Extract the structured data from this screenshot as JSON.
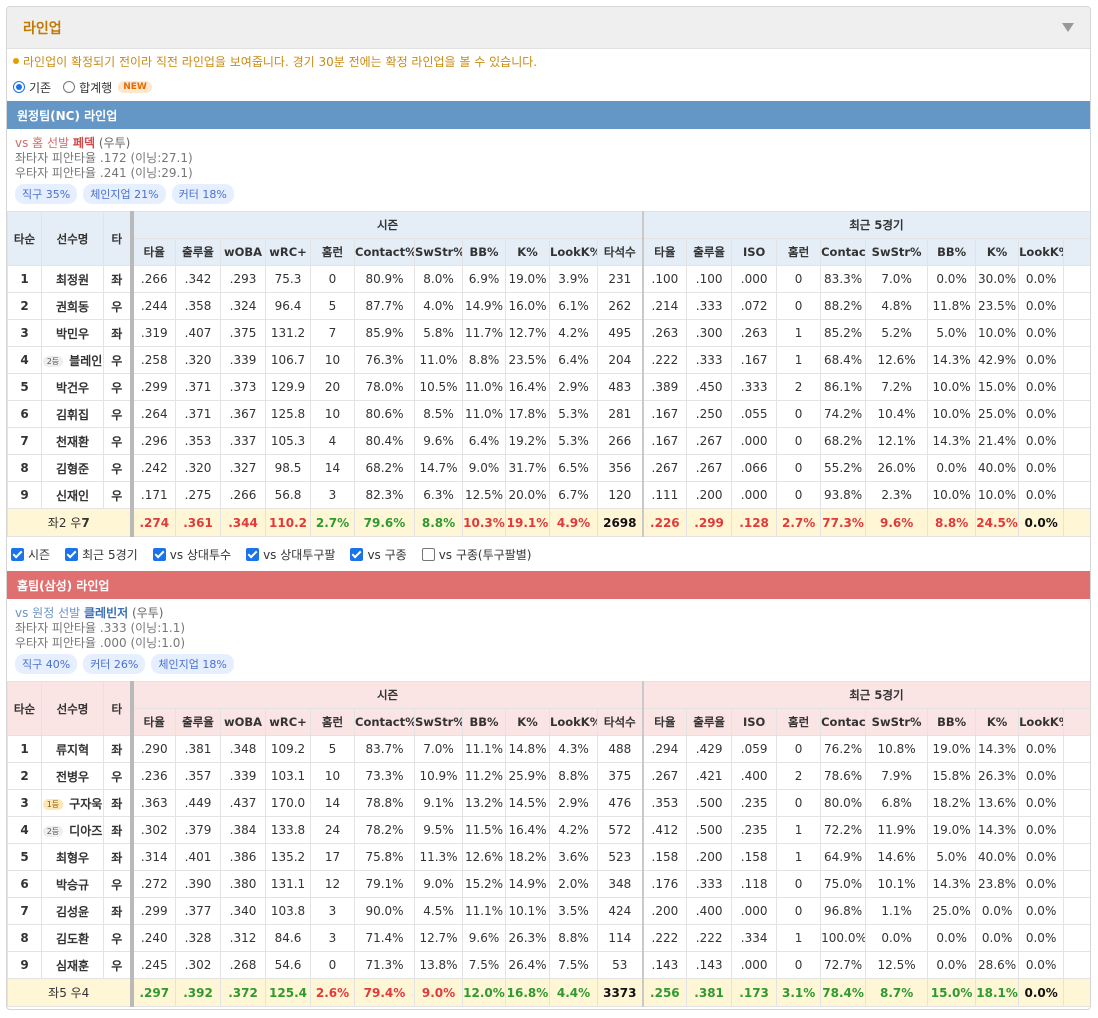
{
  "panel": {
    "title": "라인업"
  },
  "notice": "라인업이 확정되기 전이라 직전 라인업을 보여줍니다. 경기 30분 전에는 확정 라인업을 볼 수 있습니다.",
  "view_options": [
    {
      "label": "기존",
      "selected": true
    },
    {
      "label": "합계행",
      "selected": false,
      "badge": "NEW"
    }
  ],
  "columns": {
    "fixed": [
      "타순",
      "선수명",
      "타"
    ],
    "season_group": "시즌",
    "recent_group": "최근 5경기",
    "season": [
      "타율",
      "출루율",
      "wOBA",
      "wRC+",
      "홈런",
      "Contact%",
      "SwStr%",
      "BB%",
      "K%",
      "LookK%",
      "타석수"
    ],
    "recent": [
      "타율",
      "출루율",
      "ISO",
      "홈런",
      "Contact%",
      "SwStr%",
      "BB%",
      "K%",
      "LookK%"
    ]
  },
  "away": {
    "header": "원정팀(NC) 라인업",
    "vs_prefix": "vs 홈 선발",
    "pitcher": "페덱",
    "pitcher_hand": "(우투)",
    "split_left": "좌타자 피안타율 .172 (이닝:27.1)",
    "split_right": "우타자 피안타율 .241 (이닝:29.1)",
    "pitch_mix": [
      "직구 35%",
      "체인지업 21%",
      "커터 18%"
    ],
    "rows": [
      {
        "order": "1",
        "badge": "",
        "name": "최정원",
        "hand": "좌",
        "season": [
          ".266",
          ".342",
          ".293",
          "75.3",
          "0",
          "80.9%",
          "8.0%",
          "6.9%",
          "19.0%",
          "3.9%",
          "231"
        ],
        "recent": [
          ".100",
          ".100",
          ".000",
          "0",
          "83.3%",
          "7.0%",
          "0.0%",
          "30.0%",
          "0.0%"
        ]
      },
      {
        "order": "2",
        "badge": "",
        "name": "권희동",
        "hand": "우",
        "season": [
          ".244",
          ".358",
          ".324",
          "96.4",
          "5",
          "87.7%",
          "4.0%",
          "14.9%",
          "16.0%",
          "6.1%",
          "262"
        ],
        "recent": [
          ".214",
          ".333",
          ".072",
          "0",
          "88.2%",
          "4.8%",
          "11.8%",
          "23.5%",
          "0.0%"
        ]
      },
      {
        "order": "3",
        "badge": "",
        "name": "박민우",
        "hand": "좌",
        "season": [
          ".319",
          ".407",
          ".375",
          "131.2",
          "7",
          "85.9%",
          "5.8%",
          "11.7%",
          "12.7%",
          "4.2%",
          "495"
        ],
        "recent": [
          ".263",
          ".300",
          ".263",
          "1",
          "85.2%",
          "5.2%",
          "5.0%",
          "10.0%",
          "0.0%"
        ]
      },
      {
        "order": "4",
        "badge": "2등",
        "name": "블레인",
        "hand": "우",
        "season": [
          ".258",
          ".320",
          ".339",
          "106.7",
          "10",
          "76.3%",
          "11.0%",
          "8.8%",
          "23.5%",
          "6.4%",
          "204"
        ],
        "recent": [
          ".222",
          ".333",
          ".167",
          "1",
          "68.4%",
          "12.6%",
          "14.3%",
          "42.9%",
          "0.0%"
        ]
      },
      {
        "order": "5",
        "badge": "",
        "name": "박건우",
        "hand": "우",
        "season": [
          ".299",
          ".371",
          ".373",
          "129.9",
          "20",
          "78.0%",
          "10.5%",
          "11.0%",
          "16.4%",
          "2.9%",
          "483"
        ],
        "recent": [
          ".389",
          ".450",
          ".333",
          "2",
          "86.1%",
          "7.2%",
          "10.0%",
          "15.0%",
          "0.0%"
        ]
      },
      {
        "order": "6",
        "badge": "",
        "name": "김휘집",
        "hand": "우",
        "season": [
          ".264",
          ".371",
          ".367",
          "125.8",
          "10",
          "80.6%",
          "8.5%",
          "11.0%",
          "17.8%",
          "5.3%",
          "281"
        ],
        "recent": [
          ".167",
          ".250",
          ".055",
          "0",
          "74.2%",
          "10.4%",
          "10.0%",
          "25.0%",
          "0.0%"
        ]
      },
      {
        "order": "7",
        "badge": "",
        "name": "천재환",
        "hand": "우",
        "season": [
          ".296",
          ".353",
          ".337",
          "105.3",
          "4",
          "80.4%",
          "9.6%",
          "6.4%",
          "19.2%",
          "5.3%",
          "266"
        ],
        "recent": [
          ".167",
          ".267",
          ".000",
          "0",
          "68.2%",
          "12.1%",
          "14.3%",
          "21.4%",
          "0.0%"
        ]
      },
      {
        "order": "8",
        "badge": "",
        "name": "김형준",
        "hand": "우",
        "season": [
          ".242",
          ".320",
          ".327",
          "98.5",
          "14",
          "68.2%",
          "14.7%",
          "9.0%",
          "31.7%",
          "6.5%",
          "356"
        ],
        "recent": [
          ".267",
          ".267",
          ".066",
          "0",
          "55.2%",
          "26.0%",
          "0.0%",
          "40.0%",
          "0.0%"
        ]
      },
      {
        "order": "9",
        "badge": "",
        "name": "신재인",
        "hand": "우",
        "season": [
          ".171",
          ".275",
          ".266",
          "56.8",
          "3",
          "82.3%",
          "6.3%",
          "12.5%",
          "20.0%",
          "6.7%",
          "120"
        ],
        "recent": [
          ".111",
          ".200",
          ".000",
          "0",
          "93.8%",
          "2.3%",
          "10.0%",
          "10.0%",
          "0.0%"
        ]
      }
    ],
    "total": {
      "left_prefix": "좌2 우",
      "left_strong": "7",
      "season": [
        ".274",
        ".361",
        ".344",
        "110.2",
        "2.7%",
        "79.6%",
        "8.8%",
        "10.3%",
        "19.1%",
        "4.9%",
        "2698"
      ],
      "season_colors": [
        "red",
        "red",
        "red",
        "red",
        "green",
        "green",
        "green",
        "red",
        "red",
        "red",
        "black"
      ],
      "recent": [
        ".226",
        ".299",
        ".128",
        "2.7%",
        "77.3%",
        "9.6%",
        "8.8%",
        "24.5%",
        "0.0%"
      ],
      "recent_colors": [
        "red",
        "red",
        "red",
        "red",
        "red",
        "red",
        "red",
        "red",
        "black"
      ]
    }
  },
  "filters": [
    {
      "label": "시즌",
      "checked": true
    },
    {
      "label": "최근 5경기",
      "checked": true
    },
    {
      "label": "vs 상대투수",
      "checked": true
    },
    {
      "label": "vs 상대투구팔",
      "checked": true
    },
    {
      "label": "vs 구종",
      "checked": true
    },
    {
      "label": "vs 구종(투구팔별)",
      "checked": false
    }
  ],
  "home": {
    "header": "홈팀(삼성) 라인업",
    "vs_prefix": "vs 원정 선발",
    "pitcher": "클레빈저",
    "pitcher_hand": "(우투)",
    "split_left": "좌타자 피안타율 .333 (이닝:1.1)",
    "split_right": "우타자 피안타율 .000 (이닝:1.0)",
    "pitch_mix": [
      "직구 40%",
      "커터 26%",
      "체인지업 18%"
    ],
    "rows": [
      {
        "order": "1",
        "badge": "",
        "name": "류지혁",
        "hand": "좌",
        "season": [
          ".290",
          ".381",
          ".348",
          "109.2",
          "5",
          "83.7%",
          "7.0%",
          "11.1%",
          "14.8%",
          "4.3%",
          "488"
        ],
        "recent": [
          ".294",
          ".429",
          ".059",
          "0",
          "76.2%",
          "10.8%",
          "19.0%",
          "14.3%",
          "0.0%"
        ]
      },
      {
        "order": "2",
        "badge": "",
        "name": "전병우",
        "hand": "우",
        "season": [
          ".236",
          ".357",
          ".339",
          "103.1",
          "10",
          "73.3%",
          "10.9%",
          "11.2%",
          "25.9%",
          "8.8%",
          "375"
        ],
        "recent": [
          ".267",
          ".421",
          ".400",
          "2",
          "78.6%",
          "7.9%",
          "15.8%",
          "26.3%",
          "0.0%"
        ]
      },
      {
        "order": "3",
        "badge": "1등",
        "name": "구자욱",
        "hand": "좌",
        "season": [
          ".363",
          ".449",
          ".437",
          "170.0",
          "14",
          "78.8%",
          "9.1%",
          "13.2%",
          "14.5%",
          "2.9%",
          "476"
        ],
        "recent": [
          ".353",
          ".500",
          ".235",
          "0",
          "80.0%",
          "6.8%",
          "18.2%",
          "13.6%",
          "0.0%"
        ]
      },
      {
        "order": "4",
        "badge": "2등",
        "name": "디아즈",
        "hand": "좌",
        "season": [
          ".302",
          ".379",
          ".384",
          "133.8",
          "24",
          "78.2%",
          "9.5%",
          "11.5%",
          "16.4%",
          "4.2%",
          "572"
        ],
        "recent": [
          ".412",
          ".500",
          ".235",
          "1",
          "72.2%",
          "11.9%",
          "19.0%",
          "14.3%",
          "0.0%"
        ]
      },
      {
        "order": "5",
        "badge": "",
        "name": "최형우",
        "hand": "좌",
        "season": [
          ".314",
          ".401",
          ".386",
          "135.2",
          "17",
          "75.8%",
          "11.3%",
          "12.6%",
          "18.2%",
          "3.6%",
          "523"
        ],
        "recent": [
          ".158",
          ".200",
          ".158",
          "1",
          "64.9%",
          "14.6%",
          "5.0%",
          "40.0%",
          "0.0%"
        ]
      },
      {
        "order": "6",
        "badge": "",
        "name": "박승규",
        "hand": "우",
        "season": [
          ".272",
          ".390",
          ".380",
          "131.1",
          "12",
          "79.1%",
          "9.0%",
          "15.2%",
          "14.9%",
          "2.0%",
          "348"
        ],
        "recent": [
          ".176",
          ".333",
          ".118",
          "0",
          "75.0%",
          "10.1%",
          "14.3%",
          "23.8%",
          "0.0%"
        ]
      },
      {
        "order": "7",
        "badge": "",
        "name": "김성윤",
        "hand": "좌",
        "season": [
          ".299",
          ".377",
          ".340",
          "103.8",
          "3",
          "90.0%",
          "4.5%",
          "11.1%",
          "10.1%",
          "3.5%",
          "424"
        ],
        "recent": [
          ".200",
          ".400",
          ".000",
          "0",
          "96.8%",
          "1.1%",
          "25.0%",
          "0.0%",
          "0.0%"
        ]
      },
      {
        "order": "8",
        "badge": "",
        "name": "김도환",
        "hand": "우",
        "season": [
          ".240",
          ".328",
          ".312",
          "84.6",
          "3",
          "71.4%",
          "12.7%",
          "9.6%",
          "26.3%",
          "8.8%",
          "114"
        ],
        "recent": [
          ".222",
          ".222",
          ".334",
          "1",
          "100.0%",
          "0.0%",
          "0.0%",
          "0.0%",
          "0.0%"
        ]
      },
      {
        "order": "9",
        "badge": "",
        "name": "심재훈",
        "hand": "우",
        "season": [
          ".245",
          ".302",
          ".268",
          "54.6",
          "0",
          "71.3%",
          "13.8%",
          "7.5%",
          "26.4%",
          "7.5%",
          "53"
        ],
        "recent": [
          ".143",
          ".143",
          ".000",
          "0",
          "72.7%",
          "12.5%",
          "0.0%",
          "28.6%",
          "0.0%"
        ]
      }
    ],
    "total": {
      "left_prefix": "좌5 우4",
      "left_strong": "",
      "season": [
        ".297",
        ".392",
        ".372",
        "125.4",
        "2.6%",
        "79.4%",
        "9.0%",
        "12.0%",
        "16.8%",
        "4.4%",
        "3373"
      ],
      "season_colors": [
        "green",
        "green",
        "green",
        "green",
        "red",
        "red",
        "red",
        "green",
        "green",
        "green",
        "black"
      ],
      "recent": [
        ".256",
        ".381",
        ".173",
        "3.1%",
        "78.4%",
        "8.7%",
        "15.0%",
        "18.1%",
        "0.0%"
      ],
      "recent_colors": [
        "green",
        "green",
        "green",
        "green",
        "green",
        "green",
        "green",
        "green",
        "black"
      ]
    }
  }
}
